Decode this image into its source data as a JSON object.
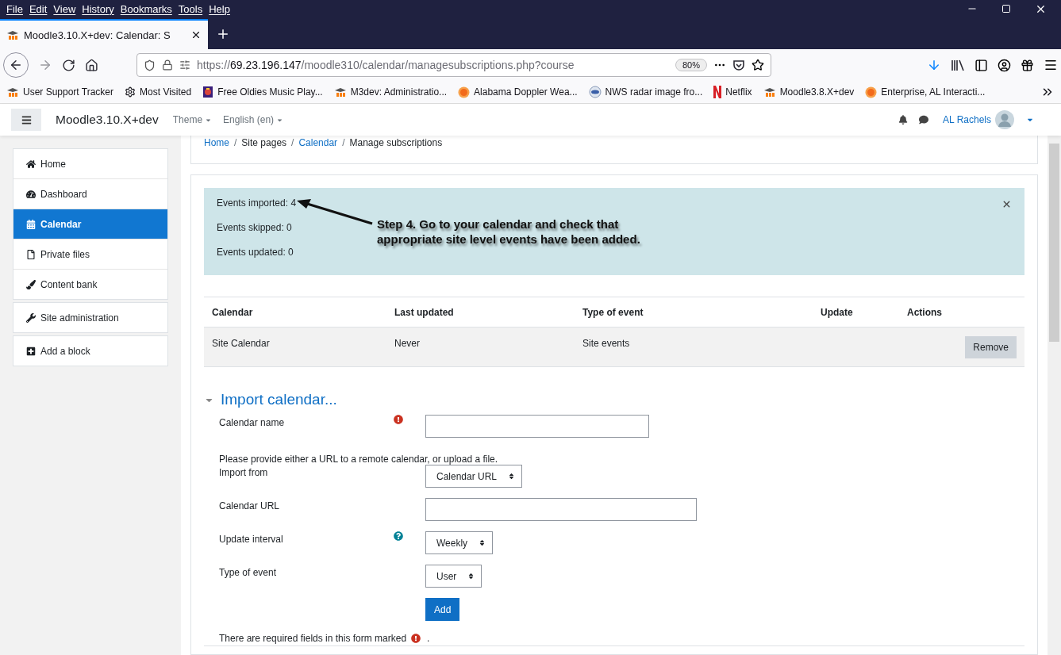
{
  "menu": [
    "File",
    "Edit",
    "View",
    "History",
    "Bookmarks",
    "Tools",
    "Help"
  ],
  "tabs": [
    {
      "title": "Moodle3.10.X+dev: Calendar: S",
      "selected": true
    }
  ],
  "nav_buttons": [
    {
      "kind": "back",
      "disabled": false
    },
    {
      "kind": "forward",
      "disabled": true
    },
    {
      "kind": "reload",
      "disabled": false
    },
    {
      "kind": "home",
      "disabled": false
    }
  ],
  "address": {
    "scheme": "https://",
    "host": "69.23.196.147",
    "path": "/moodle310/calendar/managesubscriptions.php?course",
    "zoom": "80%"
  },
  "bookmarks": [
    {
      "label": "User Support Tracker",
      "kind": "moodle"
    },
    {
      "label": "Most Visited",
      "kind": "gear"
    },
    {
      "label": "Free Oldies Music Play...",
      "kind": "radio"
    },
    {
      "label": "M3dev: Administratio...",
      "kind": "moodle"
    },
    {
      "label": "Alabama Doppler Wea...",
      "kind": "sun"
    },
    {
      "label": "NWS radar image fro...",
      "kind": "globe"
    },
    {
      "label": "Netflix",
      "kind": "netflix"
    },
    {
      "label": "Moodle3.8.X+dev",
      "kind": "moodle"
    },
    {
      "label": "Enterprise, AL Interacti...",
      "kind": "sun"
    }
  ],
  "site": {
    "brand": "Moodle3.10.X+dev",
    "menus": [
      "Theme",
      "English (en)"
    ],
    "user": "AL Rachels"
  },
  "sidebar": [
    {
      "items": [
        {
          "label": "Home",
          "kind": "home",
          "selected": false
        },
        {
          "label": "Dashboard",
          "kind": "dashboard",
          "selected": false
        },
        {
          "label": "Calendar",
          "kind": "calendar",
          "selected": true
        },
        {
          "label": "Private files",
          "kind": "file",
          "selected": false
        },
        {
          "label": "Content bank",
          "kind": "brush",
          "selected": false
        }
      ]
    },
    {
      "items": [
        {
          "label": "Site administration",
          "kind": "wrench",
          "selected": false
        }
      ]
    },
    {
      "items": [
        {
          "label": "Add a block",
          "kind": "plus",
          "selected": false
        }
      ]
    }
  ],
  "breadcrumb": {
    "separator": "/",
    "items": [
      {
        "label": "Home",
        "link": true
      },
      {
        "label": "Site pages",
        "link": false
      },
      {
        "label": "Calendar",
        "link": true
      },
      {
        "label": "Manage subscriptions",
        "link": false
      }
    ]
  },
  "alert": {
    "lines": [
      "Events imported: 4",
      "Events skipped: 0",
      "Events updated: 0"
    ],
    "annotation": [
      "Step 4. Go to your calendar and check that",
      "appropriate site level events have been added."
    ]
  },
  "table": {
    "columns": [
      "Calendar",
      "Last updated",
      "Type of event",
      "Update",
      "Actions"
    ],
    "rows": [
      {
        "cells": [
          "Site Calendar",
          "Never",
          "Site events",
          ""
        ],
        "action": "Remove"
      }
    ]
  },
  "form": {
    "title": "Import calendar...",
    "expanded": true,
    "rows": [
      {
        "kind": "text",
        "label": "Calendar name",
        "required": true
      },
      {
        "kind": "note",
        "text": "Please provide either a URL to a remote calendar, or upload a file."
      },
      {
        "kind": "select",
        "label": "Import from",
        "value": "Calendar URL"
      },
      {
        "kind": "url",
        "label": "Calendar URL"
      },
      {
        "kind": "select",
        "label": "Update interval",
        "help": true,
        "value": "Weekly"
      },
      {
        "kind": "select",
        "label": "Type of event",
        "value": "User"
      },
      {
        "kind": "button",
        "label": "Add"
      }
    ],
    "footer": {
      "before": "There are required fields in this form marked",
      "after": "."
    }
  }
}
